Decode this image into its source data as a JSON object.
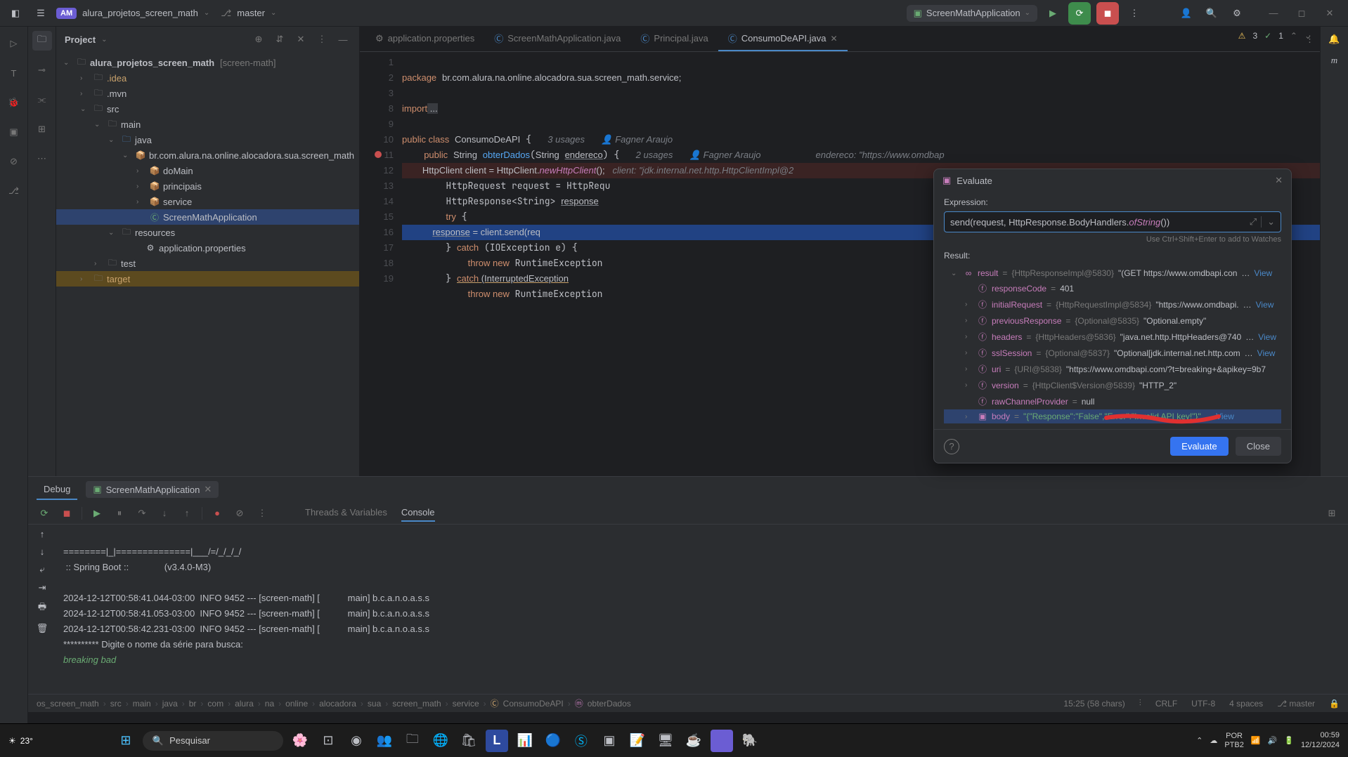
{
  "titlebar": {
    "project_badge": "AM",
    "project_name": "alura_projetos_screen_math",
    "branch_label": "master",
    "run_config": "ScreenMathApplication"
  },
  "project_panel": {
    "title": "Project",
    "root": "alura_projetos_screen_math",
    "root_suffix": "[screen-math]",
    "items": {
      "idea": ".idea",
      "mvn": ".mvn",
      "src": "src",
      "main": "main",
      "java": "java",
      "pkg": "br.com.alura.na.online.alocadora.sua.screen_math",
      "domain": "doMain",
      "principais": "principais",
      "service": "service",
      "app_class": "ScreenMathApplication",
      "resources": "resources",
      "app_props": "application.properties",
      "test": "test",
      "target": "target"
    }
  },
  "tabs": {
    "t1": "application.properties",
    "t2": "ScreenMathApplication.java",
    "t3": "Principal.java",
    "t4": "ConsumoDeAPI.java"
  },
  "editor_badges": {
    "warn": "3",
    "ok": "1"
  },
  "code": {
    "l1": "package br.com.alura.na.online.alocadora.sua.screen_math.service;",
    "l3_kw": "import",
    "l3_rest": " ...",
    "l9": "public class ConsumoDeAPI {",
    "l9_usages": "3 usages",
    "l9_author": "Fagner Araujo",
    "l10_a": "    public String ",
    "l10_fn": "obterDados",
    "l10_b": "(String ",
    "l10_p": "endereco",
    "l10_c": ") {",
    "l10_usages": "2 usages",
    "l10_author": "Fagner Araujo",
    "l10_hint": "endereco: \"https://www.omdbap",
    "l11": "        HttpClient client = HttpClient.",
    "l11_fn": "newHttpClient",
    "l11_b": "();",
    "l11_hint": "client: \"jdk.internal.net.http.HttpClientImpl@2",
    "l12": "        HttpRequest request = HttpRequ",
    "l13": "        HttpResponse<String> ",
    "l13_u": "response",
    "l14": "        try {",
    "l15": "            ",
    "l15_u": "response",
    "l15_b": " = client.send(req",
    "l16": "        } catch (IOException e) {",
    "l17": "            throw new RuntimeException",
    "l18_a": "        } ",
    "l18_u": "catch (InterruptedException",
    "l19": "            throw new RuntimeException"
  },
  "debug": {
    "tab_label": "Debug",
    "run_tab": "ScreenMathApplication",
    "subtab1": "Threads & Variables",
    "subtab2": "Console"
  },
  "console": {
    "l0": "========|_|==============|___/=/_/_/_/",
    "l1": " :: Spring Boot ::              (v3.4.0-M3)",
    "l2": "",
    "l3": "2024-12-12T00:58:41.044-03:00  INFO 9452 --- [screen-math] [           main] b.c.a.n.o.a.s.s",
    "l4": "2024-12-12T00:58:41.053-03:00  INFO 9452 --- [screen-math] [           main] b.c.a.n.o.a.s.s",
    "l5": "2024-12-12T00:58:42.231-03:00  INFO 9452 --- [screen-math] [           main] b.c.a.n.o.a.s.s",
    "l6": "********** Digite o nome da série para busca:",
    "l7": "breaking bad"
  },
  "evaluate": {
    "title": "Evaluate",
    "expr_label": "Expression:",
    "expr_value": "send(request, HttpResponse.BodyHandlers.ofString())",
    "hint": "Use Ctrl+Shift+Enter to add to Watches",
    "result_label": "Result:",
    "rows": {
      "result": {
        "name": "result",
        "type": "{HttpResponseImpl@5830}",
        "val": "\"(GET https://www.omdbapi.con"
      },
      "responseCode": {
        "name": "responseCode",
        "val": "401"
      },
      "initialRequest": {
        "name": "initialRequest",
        "type": "{HttpRequestImpl@5834}",
        "val": "\"https://www.omdbapi."
      },
      "previousResponse": {
        "name": "previousResponse",
        "type": "{Optional@5835}",
        "val": "\"Optional.empty\""
      },
      "headers": {
        "name": "headers",
        "type": "{HttpHeaders@5836}",
        "val": "\"java.net.http.HttpHeaders@740"
      },
      "sslSession": {
        "name": "sslSession",
        "type": "{Optional@5837}",
        "val": "\"Optional[jdk.internal.net.http.com"
      },
      "uri": {
        "name": "uri",
        "type": "{URI@5838}",
        "val": "\"https://www.omdbapi.com/?t=breaking+&apikey=9b7"
      },
      "version": {
        "name": "version",
        "type": "{HttpClient$Version@5839}",
        "val": "\"HTTP_2\""
      },
      "rawChannelProvider": {
        "name": "rawChannelProvider",
        "val": "null"
      },
      "body": {
        "name": "body",
        "val": "\"{\"Response\":\"False\",\"Error\":\"Invalid API key!\"}\" …"
      }
    },
    "view": "View",
    "btn_eval": "Evaluate",
    "btn_close": "Close"
  },
  "breadcrumb": {
    "p0": "os_screen_math",
    "p1": "src",
    "p2": "main",
    "p3": "java",
    "p4": "br",
    "p5": "com",
    "p6": "alura",
    "p7": "na",
    "p8": "online",
    "p9": "alocadora",
    "p10": "sua",
    "p11": "screen_math",
    "p12": "service",
    "p13": "ConsumoDeAPI",
    "p14": "obterDados",
    "pos": "15:25 (58 chars)",
    "eol": "CRLF",
    "enc": "UTF-8",
    "indent": "4 spaces",
    "branch": "master"
  },
  "taskbar": {
    "temp": "23°",
    "search_placeholder": "Pesquisar",
    "lang1": "POR",
    "lang2": "PTB2",
    "time": "00:59",
    "date": "12/12/2024"
  }
}
